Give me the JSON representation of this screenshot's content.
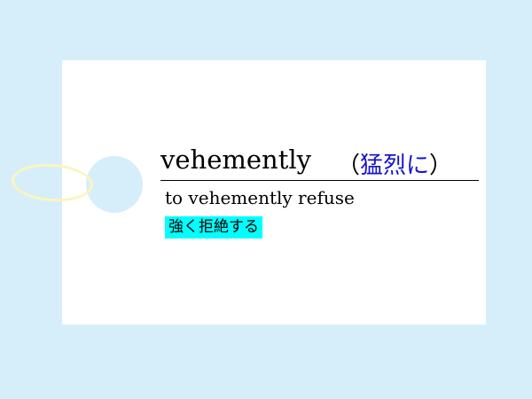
{
  "card": {
    "headword": "vehemently",
    "meaning_open": "（",
    "meaning": "猛烈に",
    "meaning_close": "）",
    "example": "to vehemently refuse",
    "translation": "強く拒絶する"
  },
  "colors": {
    "background": "#d6eef9",
    "card": "#ffffff",
    "meaning": "#1414c8",
    "highlight": "#00ffff",
    "ring": "#fbf5bd"
  }
}
